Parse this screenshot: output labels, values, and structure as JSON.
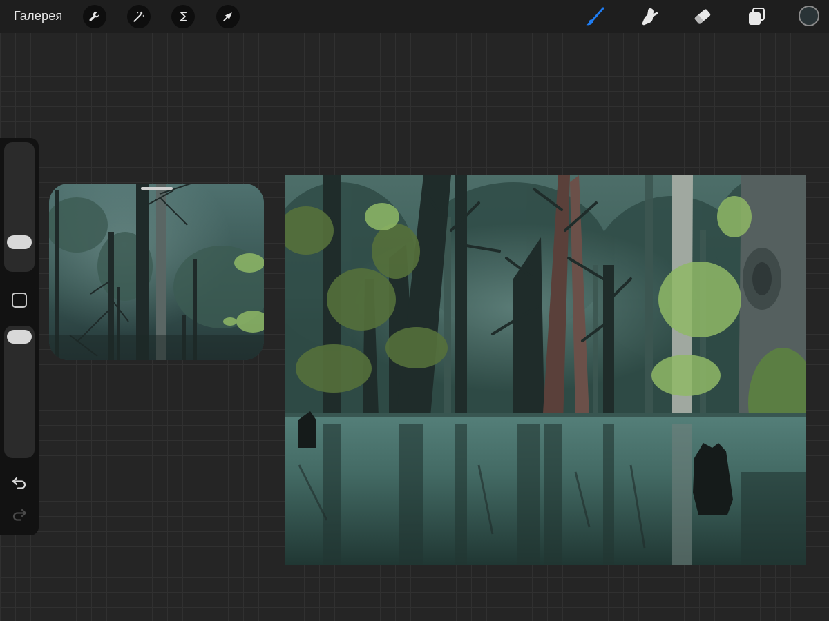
{
  "topbar": {
    "gallery_label": "Галерея",
    "left_tools": [
      {
        "name": "actions",
        "icon": "wrench-icon"
      },
      {
        "name": "adjustments",
        "icon": "magic-wand-icon"
      },
      {
        "name": "selection",
        "icon": "selection-s-icon"
      },
      {
        "name": "transform",
        "icon": "arrow-cursor-icon"
      }
    ],
    "right_tools": [
      {
        "name": "brush",
        "icon": "brush-icon",
        "active": true
      },
      {
        "name": "smudge",
        "icon": "smudge-finger-icon",
        "active": false
      },
      {
        "name": "eraser",
        "icon": "eraser-icon",
        "active": false
      },
      {
        "name": "layers",
        "icon": "layers-icon",
        "active": false
      }
    ],
    "active_color": "#2a3437",
    "brush_accent_color": "#1e7cf2"
  },
  "sidebar": {
    "brush_size": 0.36,
    "brush_opacity": 0.95,
    "modify_icon": "square-modify-icon",
    "undo_icon": "undo-arrow-icon",
    "redo_icon": "redo-arrow-icon",
    "redo_enabled": false
  },
  "reference_window": {
    "content": "forest-reference-photo"
  },
  "artwork": {
    "content": "flooded-forest-painting"
  }
}
